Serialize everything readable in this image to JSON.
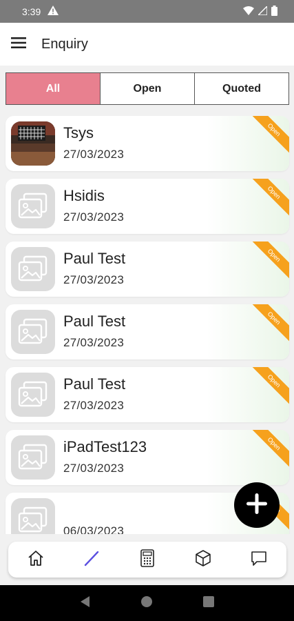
{
  "status_bar": {
    "time": "3:39"
  },
  "app_bar": {
    "title": "Enquiry"
  },
  "tabs": [
    {
      "label": "All",
      "active": true
    },
    {
      "label": "Open",
      "active": false
    },
    {
      "label": "Quoted",
      "active": false
    }
  ],
  "enquiries": [
    {
      "name": "Tsys",
      "date": "27/03/2023",
      "status": "Open",
      "has_photo": true
    },
    {
      "name": "Hsidis",
      "date": "27/03/2023",
      "status": "Open",
      "has_photo": false
    },
    {
      "name": "Paul Test",
      "date": "27/03/2023",
      "status": "Open",
      "has_photo": false
    },
    {
      "name": "Paul Test",
      "date": "27/03/2023",
      "status": "Open",
      "has_photo": false
    },
    {
      "name": "Paul Test",
      "date": "27/03/2023",
      "status": "Open",
      "has_photo": false
    },
    {
      "name": "iPadTest123",
      "date": "27/03/2023",
      "status": "Open",
      "has_photo": false
    },
    {
      "name": "",
      "date": "06/03/2023",
      "status": "Open",
      "has_photo": false
    }
  ],
  "bottom_nav": [
    {
      "icon": "home-icon"
    },
    {
      "icon": "pencil-icon",
      "active": true
    },
    {
      "icon": "calculator-icon"
    },
    {
      "icon": "cube-icon"
    },
    {
      "icon": "chat-icon"
    }
  ],
  "colors": {
    "active_tab": "#e8808f",
    "ribbon": "#f6a11d",
    "active_nav": "#5b4fe0"
  }
}
